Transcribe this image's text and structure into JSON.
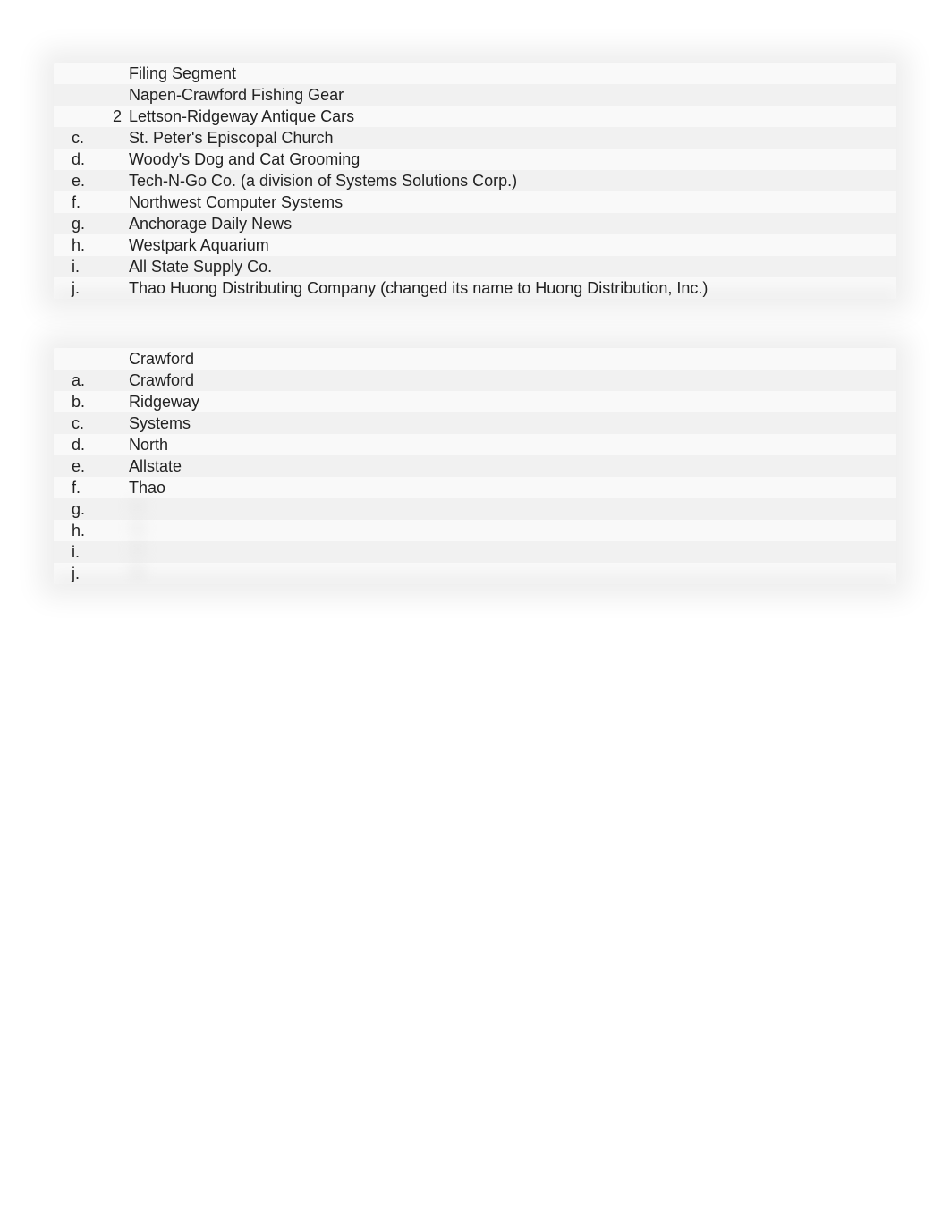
{
  "table1": {
    "rows": [
      {
        "label": "",
        "num": "",
        "text": "Filing Segment"
      },
      {
        "label": "",
        "num": "",
        "text": "Napen-Crawford Fishing Gear"
      },
      {
        "label": "",
        "num": "2",
        "text": "Lettson-Ridgeway Antique Cars"
      },
      {
        "label": "c.",
        "num": "",
        "text": "St. Peter's Episcopal Church"
      },
      {
        "label": "d.",
        "num": "",
        "text": "Woody's Dog and Cat Grooming"
      },
      {
        "label": "e.",
        "num": "",
        "text": "Tech-N-Go Co. (a division of Systems Solutions Corp.)"
      },
      {
        "label": "f.",
        "num": "",
        "text": "Northwest Computer Systems"
      },
      {
        "label": "g.",
        "num": "",
        "text": "Anchorage Daily News"
      },
      {
        "label": "h.",
        "num": "",
        "text": "Westpark Aquarium"
      },
      {
        "label": "i.",
        "num": "",
        "text": "All State Supply Co."
      },
      {
        "label": "j.",
        "num": "",
        "text": "Thao Huong Distributing Company (changed its name to Huong Distribution, Inc.)"
      }
    ]
  },
  "table2": {
    "rows": [
      {
        "label": "",
        "text": "Crawford",
        "obscured": false
      },
      {
        "label": "a.",
        "text": "Crawford",
        "obscured": false
      },
      {
        "label": "b.",
        "text": "Ridgeway",
        "obscured": false
      },
      {
        "label": "c.",
        "text": "Systems",
        "obscured": false
      },
      {
        "label": "d.",
        "text": "North",
        "obscured": false
      },
      {
        "label": "e.",
        "text": "Allstate",
        "obscured": false
      },
      {
        "label": "f.",
        "text": "Thao",
        "obscured": false
      },
      {
        "label": "g.",
        "text": "",
        "obscured": true
      },
      {
        "label": "h.",
        "text": "",
        "obscured": true
      },
      {
        "label": "i.",
        "text": "",
        "obscured": true
      },
      {
        "label": "j.",
        "text": "",
        "obscured": true
      }
    ]
  }
}
